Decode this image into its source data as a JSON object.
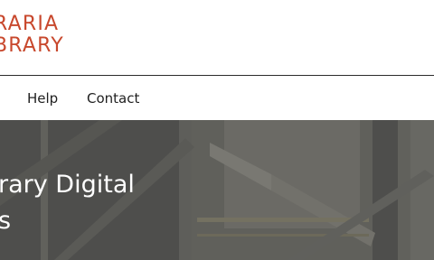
{
  "header": {
    "logo_line1": "RARIA",
    "logo_line2": "BRARY"
  },
  "nav": {
    "items": [
      {
        "label": "Help"
      },
      {
        "label": "Contact"
      }
    ]
  },
  "hero": {
    "title_line1": "rary Digital",
    "title_line2": "s"
  },
  "colors": {
    "brand": "#c8482d",
    "nav_text": "#1f1f1f",
    "hero_bg": "#575754"
  }
}
